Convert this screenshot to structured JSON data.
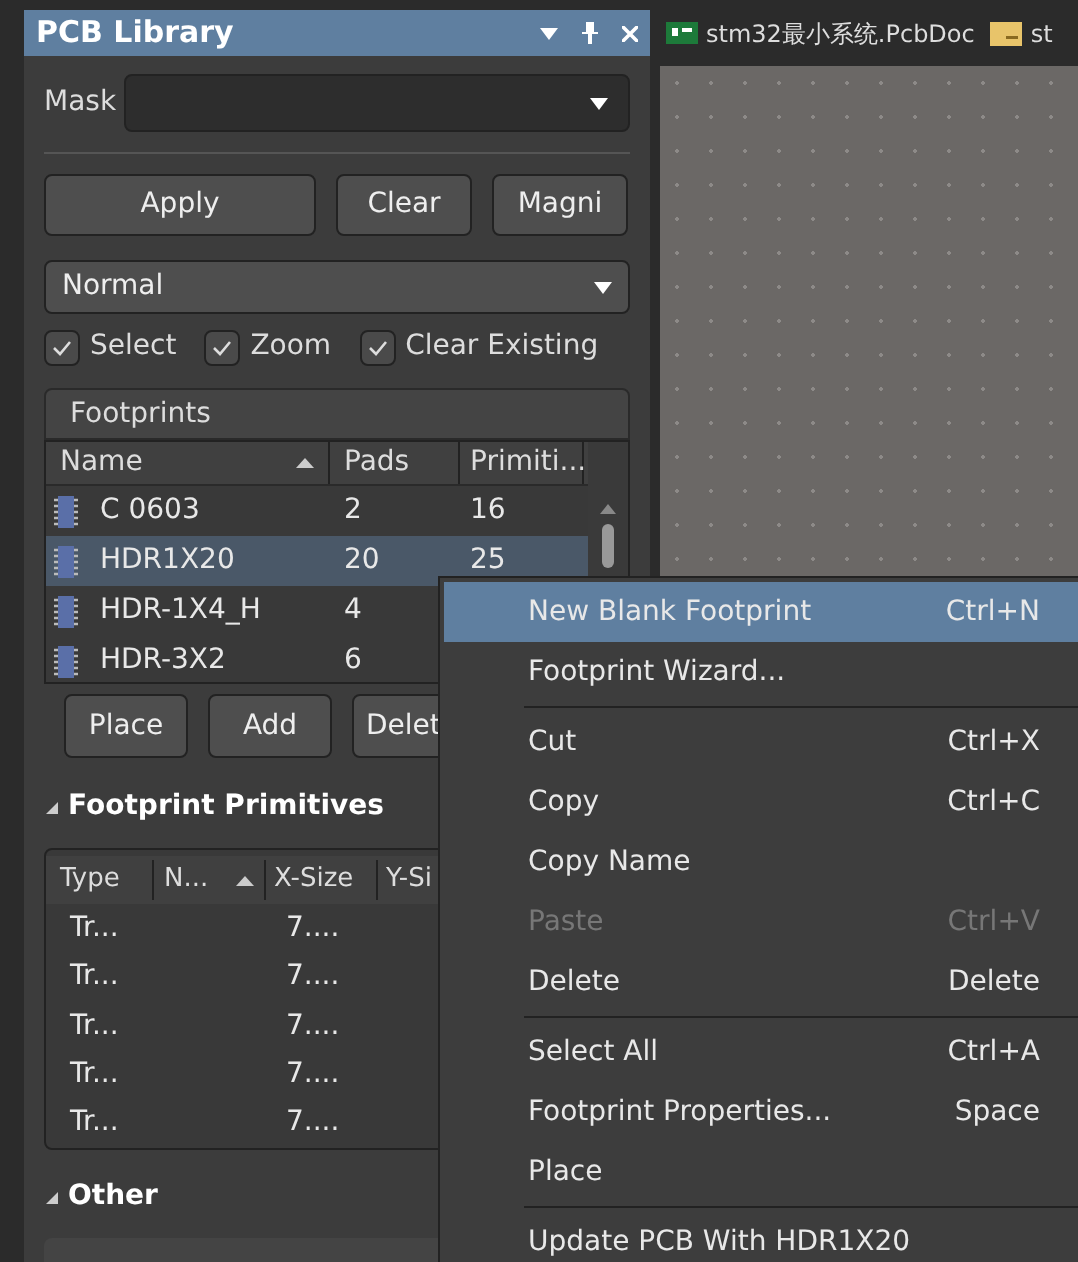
{
  "panel": {
    "title": "PCB Library",
    "mask": {
      "label": "Mask"
    },
    "buttons": [
      "Apply",
      "Clear",
      "Magni"
    ],
    "mode": "Normal",
    "checks": [
      {
        "label": "Select",
        "checked": true
      },
      {
        "label": "Zoom",
        "checked": true
      },
      {
        "label": "Clear Existing",
        "checked": true
      }
    ],
    "footprints": {
      "title": "Footprints",
      "columns": [
        "Name",
        "Pads",
        "Primiti..."
      ],
      "rows": [
        {
          "name": "C 0603",
          "pads": "2",
          "primitives": "16",
          "selected": false
        },
        {
          "name": "HDR1X20",
          "pads": "20",
          "primitives": "25",
          "selected": true
        },
        {
          "name": "HDR-1X4_H",
          "pads": "4",
          "selected": false
        },
        {
          "name": "HDR-3X2",
          "pads": "6",
          "selected": false
        }
      ],
      "buttons": [
        "Place",
        "Add",
        "Delet"
      ]
    },
    "primitives": {
      "title": "Footprint Primitives",
      "expanded": true,
      "columns": [
        "Type",
        "N...",
        "X-Size",
        "Y-Si"
      ],
      "rows": [
        [
          "Tr...",
          "7...."
        ],
        [
          "Tr...",
          "7...."
        ],
        [
          "Tr...",
          "7...."
        ],
        [
          "Tr...",
          "7...."
        ],
        [
          "Tr...",
          "7...."
        ]
      ]
    },
    "other": {
      "title": "Other",
      "expanded": true
    }
  },
  "tabs": [
    {
      "label": "stm32最小系统.PcbDoc",
      "kind": "pcb"
    },
    {
      "label": "st",
      "kind": "doc"
    }
  ],
  "context_menu": {
    "items": [
      {
        "label": "New Blank Footprint",
        "shortcut": "Ctrl+N",
        "selected": true,
        "disabled": false
      },
      {
        "label": "Footprint Wizard...",
        "selected": false,
        "disabled": false,
        "separator_after": true
      },
      {
        "label": "Cut",
        "shortcut": "Ctrl+X",
        "selected": false,
        "disabled": false
      },
      {
        "label": "Copy",
        "shortcut": "Ctrl+C",
        "selected": false,
        "disabled": false
      },
      {
        "label": "Copy Name",
        "selected": false,
        "disabled": false
      },
      {
        "label": "Paste",
        "shortcut": "Ctrl+V",
        "selected": false,
        "disabled": true
      },
      {
        "label": "Delete",
        "shortcut": "Delete",
        "selected": false,
        "disabled": false,
        "separator_after": true
      },
      {
        "label": "Select All",
        "shortcut": "Ctrl+A",
        "selected": false,
        "disabled": false
      },
      {
        "label": "Footprint Properties...",
        "shortcut": "Space",
        "selected": false,
        "disabled": false
      },
      {
        "label": "Place",
        "selected": false,
        "disabled": false,
        "separator_after": true
      },
      {
        "label": "Update PCB With HDR1X20",
        "selected": false,
        "disabled": false
      }
    ]
  }
}
